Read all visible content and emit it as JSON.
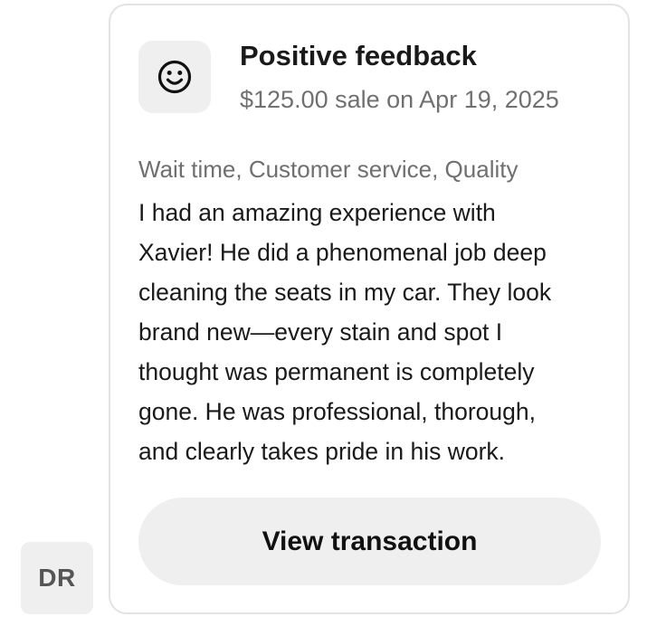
{
  "sender": {
    "initials": "DR"
  },
  "feedback_card": {
    "icon": "smiley-face-icon",
    "title": "Positive feedback",
    "subtitle": "$125.00 sale on Apr 19, 2025",
    "tags": "Wait time, Customer service, Quality",
    "review_lines": [
      "I had an amazing experience with",
      "Xavier! He did a phenomenal job deep",
      "cleaning the seats in my car. They look",
      "brand new—every stain and spot I",
      "thought was permanent is completely",
      "gone. He was professional, thorough,",
      "and clearly takes pride in his work."
    ],
    "button_label": "View transaction"
  },
  "colors": {
    "tile_background": "#efefef",
    "card_border": "#e3e3e3",
    "secondary_text": "#707070"
  }
}
